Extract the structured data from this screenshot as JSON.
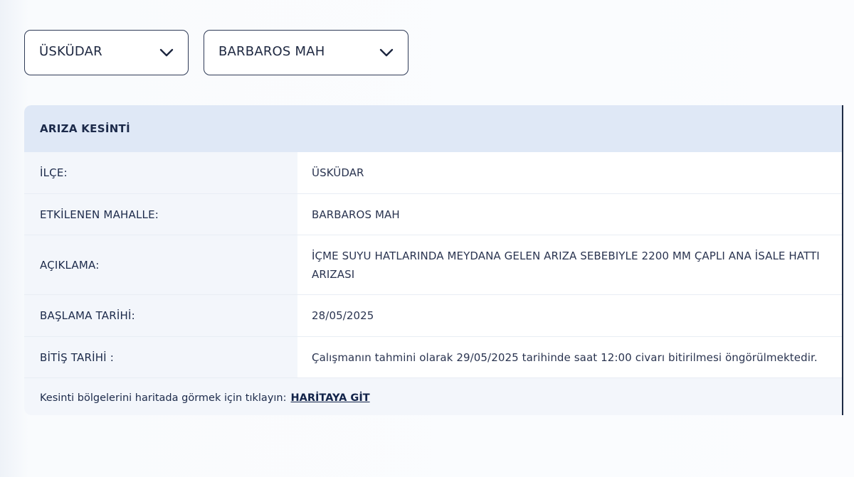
{
  "filters": {
    "district": {
      "value": "ÜSKÜDAR",
      "icon": "chevron-down-icon"
    },
    "neighborhood": {
      "value": "BARBAROS MAH",
      "icon": "chevron-down-icon"
    }
  },
  "outage_card": {
    "title": "ARIZA KESİNTİ",
    "rows": [
      {
        "label": "İLÇE:",
        "value": "ÜSKÜDAR"
      },
      {
        "label": "ETKİLENEN MAHALLE:",
        "value": "BARBAROS MAH"
      },
      {
        "label": "AÇIKLAMA:",
        "value": "İÇME SUYU HATLARINDA MEYDANA GELEN ARIZA SEBEBIYLE 2200 MM ÇAPLI ANA İSALE HATTI ARIZASI"
      },
      {
        "label": "BAŞLAMA TARİHİ:",
        "value": "28/05/2025"
      },
      {
        "label": "BİTİŞ TARİHİ :",
        "value": "Çalışmanın tahmini olarak 29/05/2025 tarihinde saat 12:00 civarı bitirilmesi öngörülmektedir."
      }
    ],
    "footer": {
      "text": "Kesinti bölgelerini haritada görmek için tıklayın:",
      "link_label": "HARİTAYA GİT"
    }
  },
  "colors": {
    "header_bg": "#dfe8f6",
    "label_bg": "#f3f6fb",
    "text_dark": "#1c2a4a",
    "border": "#2f3b57"
  }
}
